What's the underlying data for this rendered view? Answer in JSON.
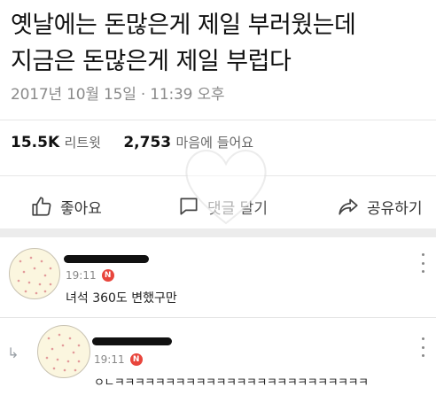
{
  "tweet": {
    "line1": "옛날에는 돈많은게 제일 부러웠는데",
    "line2": "지금은 돈많은게 제일 부럽다",
    "timestamp": "2017년 10월 15일 · 11:39 오후",
    "retweet_count": "15.5K",
    "retweet_label": "리트윗",
    "like_count": "2,753",
    "like_label": "마음에 들어요"
  },
  "actions": {
    "like": {
      "label": "좋아요",
      "icon": "thumbs-up-icon"
    },
    "comment": {
      "label": "댓글 달기",
      "icon": "speech-bubble-icon"
    },
    "share": {
      "label": "공유하기",
      "icon": "share-arrow-icon"
    }
  },
  "comments": [
    {
      "time": "19:11",
      "badge": "N",
      "text": "녀석 360도 변했구만"
    },
    {
      "time": "19:11",
      "badge": "N",
      "text": "ㅇㄴㅋㅋㅋㅋㅋㅋㅋㅋㅋㅋㅋㅋㅋㅋㅋㅋㅋㅋㅋㅋㅋㅋㅋㅋㅋ",
      "is_reply": true
    }
  ],
  "colors": {
    "badge": "#e8453c",
    "timestamp": "#8a8a8a",
    "band": "#ececec",
    "avatar_bg": "#fbf6df"
  }
}
